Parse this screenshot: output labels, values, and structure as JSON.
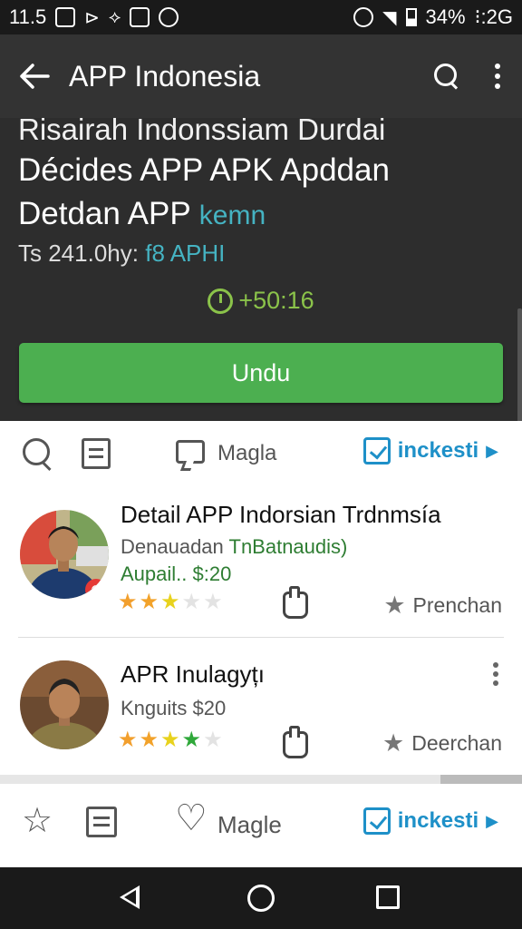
{
  "status_bar": {
    "time": "11.5",
    "battery": "34%",
    "network": "⁝:2G"
  },
  "app_bar": {
    "title": "APP Indonesia"
  },
  "hero": {
    "line1": "Risairah Indonssiam Durdai",
    "line2": "Décides APP APK Apddan",
    "line3_main": "Detdan APP",
    "line3_accent": "kemn",
    "meta_main": "Ts 241.0hy:",
    "meta_accent": "f8 APHI",
    "timer": "+50:16",
    "download_label": "Undu"
  },
  "toolbar": {
    "label": "Magla",
    "install_label": "inckesti"
  },
  "items": [
    {
      "title": "Detail APP Indorsian Trdnmsía",
      "sub_main": "Denauadan",
      "sub_accent": "TnBatnaudis)",
      "price": "Aupail.. $:20",
      "rating": 3,
      "action_label": "Prenchan"
    },
    {
      "title": "APR Inulagyțı",
      "sub_main": "Knguits $20",
      "sub_accent": "",
      "price": "",
      "rating": 4,
      "action_label": "Deerchan"
    }
  ],
  "bottom_bar": {
    "label": "Magle",
    "install_label": "inckesti"
  },
  "colors": {
    "accent_green": "#4caf50",
    "accent_teal": "#45b3c2",
    "link_blue": "#1e90c8",
    "timer_green": "#8bc34a"
  }
}
